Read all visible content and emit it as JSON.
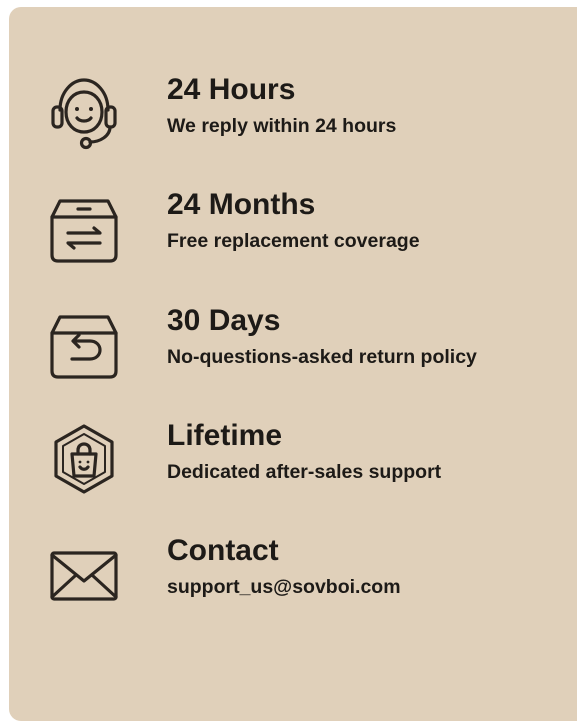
{
  "features": [
    {
      "icon": "headset-icon",
      "title": "24 Hours",
      "description": "We reply within 24 hours"
    },
    {
      "icon": "box-exchange-icon",
      "title": "24 Months",
      "description": "Free replacement coverage"
    },
    {
      "icon": "box-return-icon",
      "title": "30 Days",
      "description": "No-questions-asked return policy"
    },
    {
      "icon": "shopping-bag-hexagon-icon",
      "title": "Lifetime",
      "description": "Dedicated after-sales support"
    },
    {
      "icon": "envelope-icon",
      "title": "Contact",
      "description": "support_us@sovboi.com"
    }
  ],
  "colors": {
    "background": "#e0d0ba",
    "text": "#1d1a17"
  }
}
